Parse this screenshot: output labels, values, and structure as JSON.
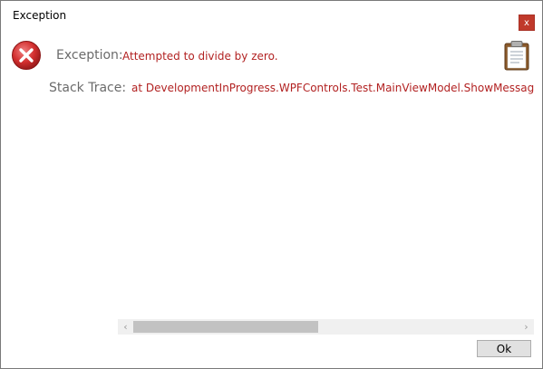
{
  "window": {
    "title": "Exception",
    "close_label": "x"
  },
  "exception": {
    "label": "Exception:",
    "message": "Attempted to divide by zero."
  },
  "stack_trace": {
    "label": "Stack Trace:",
    "text": "at DevelopmentInProgress.WPFControls.Test.MainViewModel.ShowMessageBoxes() in"
  },
  "scrollbar": {
    "left_arrow": "‹",
    "right_arrow": "›"
  },
  "buttons": {
    "ok_label": "Ok"
  },
  "icons": {
    "error": "error-icon",
    "clipboard": "clipboard-icon"
  },
  "colors": {
    "error_red": "#b22222",
    "close_button": "#c0392b",
    "label_gray": "#6b6b6b"
  }
}
